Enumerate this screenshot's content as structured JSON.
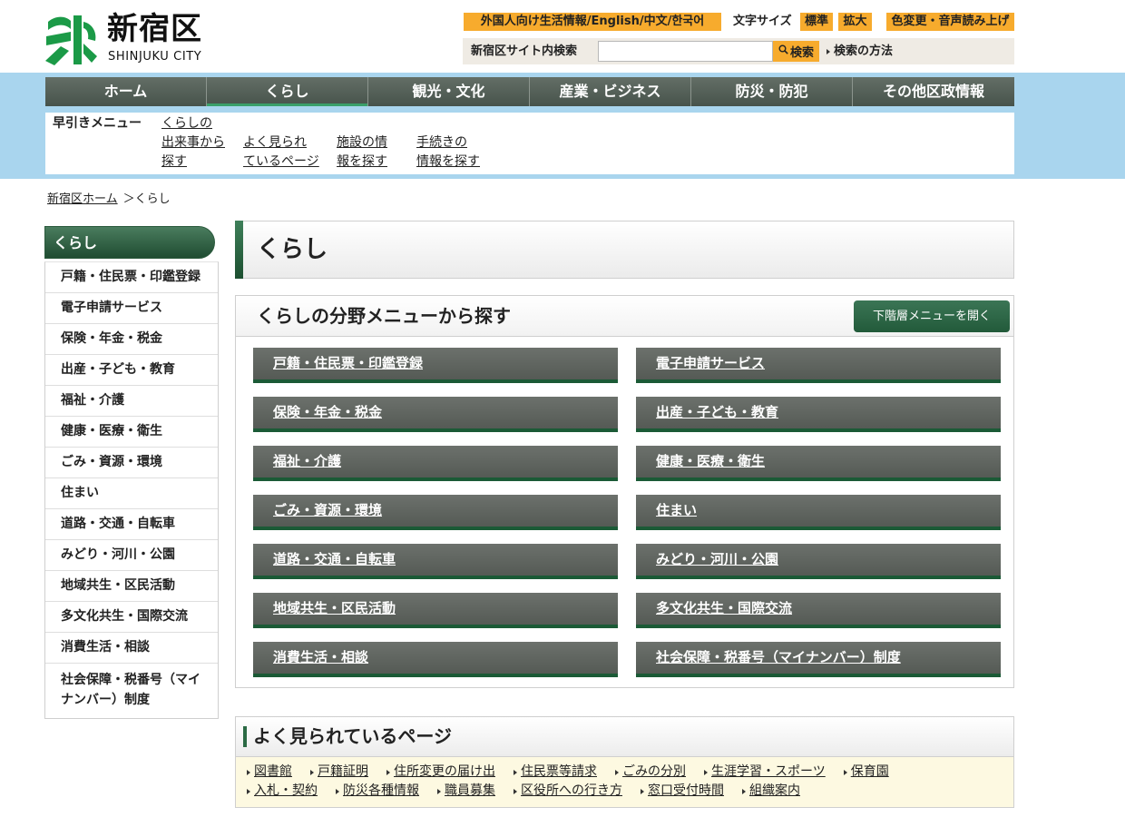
{
  "colors": {
    "accent_orange": "#f7ab2d",
    "nav_dark": "#4f5b53",
    "band_blue": "#a9d5ee",
    "brand_green": "#1b9a47",
    "button_green": "#2b6343",
    "tile_grey": "#5f645f",
    "tile_border_green": "#1b5a36",
    "popular_bg": "#fdf9e1"
  },
  "header": {
    "logo": {
      "icon": "shinjuku-emblem-icon",
      "name_ja": "新宿区",
      "name_en": "SHINJUKU CITY"
    },
    "utility": {
      "foreign": "外国人向け生活情報/English/中文/한국어",
      "font_size_label": "文字サイズ",
      "font_standard": "標準",
      "font_large": "拡大",
      "color_voice": "色変更・音声読み上げ"
    },
    "search": {
      "label": "新宿区サイト内検索",
      "value": "",
      "button": "検索",
      "button_icon": "search-icon",
      "help": "検索の方法"
    }
  },
  "nav": {
    "items": [
      "ホーム",
      "くらし",
      "観光・文化",
      "産業・ビジネス",
      "防災・防犯",
      "その他区政情報"
    ],
    "active_index": 1
  },
  "quick_menu": {
    "label": "早引きメニュー",
    "links": [
      {
        "lines": [
          "くらしの",
          "出来事から",
          "探す"
        ]
      },
      {
        "lines": [
          "よく見られ",
          "ているページ"
        ]
      },
      {
        "lines": [
          "施設の情",
          "報を探す"
        ]
      },
      {
        "lines": [
          "手続きの",
          "情報を探す"
        ]
      }
    ]
  },
  "breadcrumb": {
    "home": "新宿区ホーム",
    "separator": "＞",
    "current": "くらし"
  },
  "sidebar": {
    "title": "くらし",
    "items": [
      "戸籍・住民票・印鑑登録",
      "電子申請サービス",
      "保険・年金・税金",
      "出産・子ども・教育",
      "福祉・介護",
      "健康・医療・衛生",
      "ごみ・資源・環境",
      "住まい",
      "道路・交通・自転車",
      "みどり・河川・公園",
      "地域共生・区民活動",
      "多文化共生・国際交流",
      "消費生活・相談",
      "社会保障・税番号（マイナンバー）制度"
    ]
  },
  "page_title": "くらし",
  "category_menu": {
    "title": "くらしの分野メニューから探す",
    "expand_button": "下階層メニューを開く",
    "items": [
      "戸籍・住民票・印鑑登録",
      "電子申請サービス",
      "保険・年金・税金",
      "出産・子ども・教育",
      "福祉・介護",
      "健康・医療・衛生",
      "ごみ・資源・環境",
      "住まい",
      "道路・交通・自転車",
      "みどり・河川・公園",
      "地域共生・区民活動",
      "多文化共生・国際交流",
      "消費生活・相談",
      "社会保障・税番号（マイナンバー）制度"
    ]
  },
  "popular": {
    "title": "よく見られているページ",
    "bullet_icon": "triangle-right-icon",
    "rows": [
      [
        "図書館",
        "戸籍証明",
        "住所変更の届け出",
        "住民票等請求",
        "ごみの分別",
        "生涯学習・スポーツ",
        "保育園"
      ],
      [
        "入札・契約",
        "防災各種情報",
        "職員募集",
        "区役所への行き方",
        "窓口受付時間",
        "組織案内"
      ]
    ]
  }
}
